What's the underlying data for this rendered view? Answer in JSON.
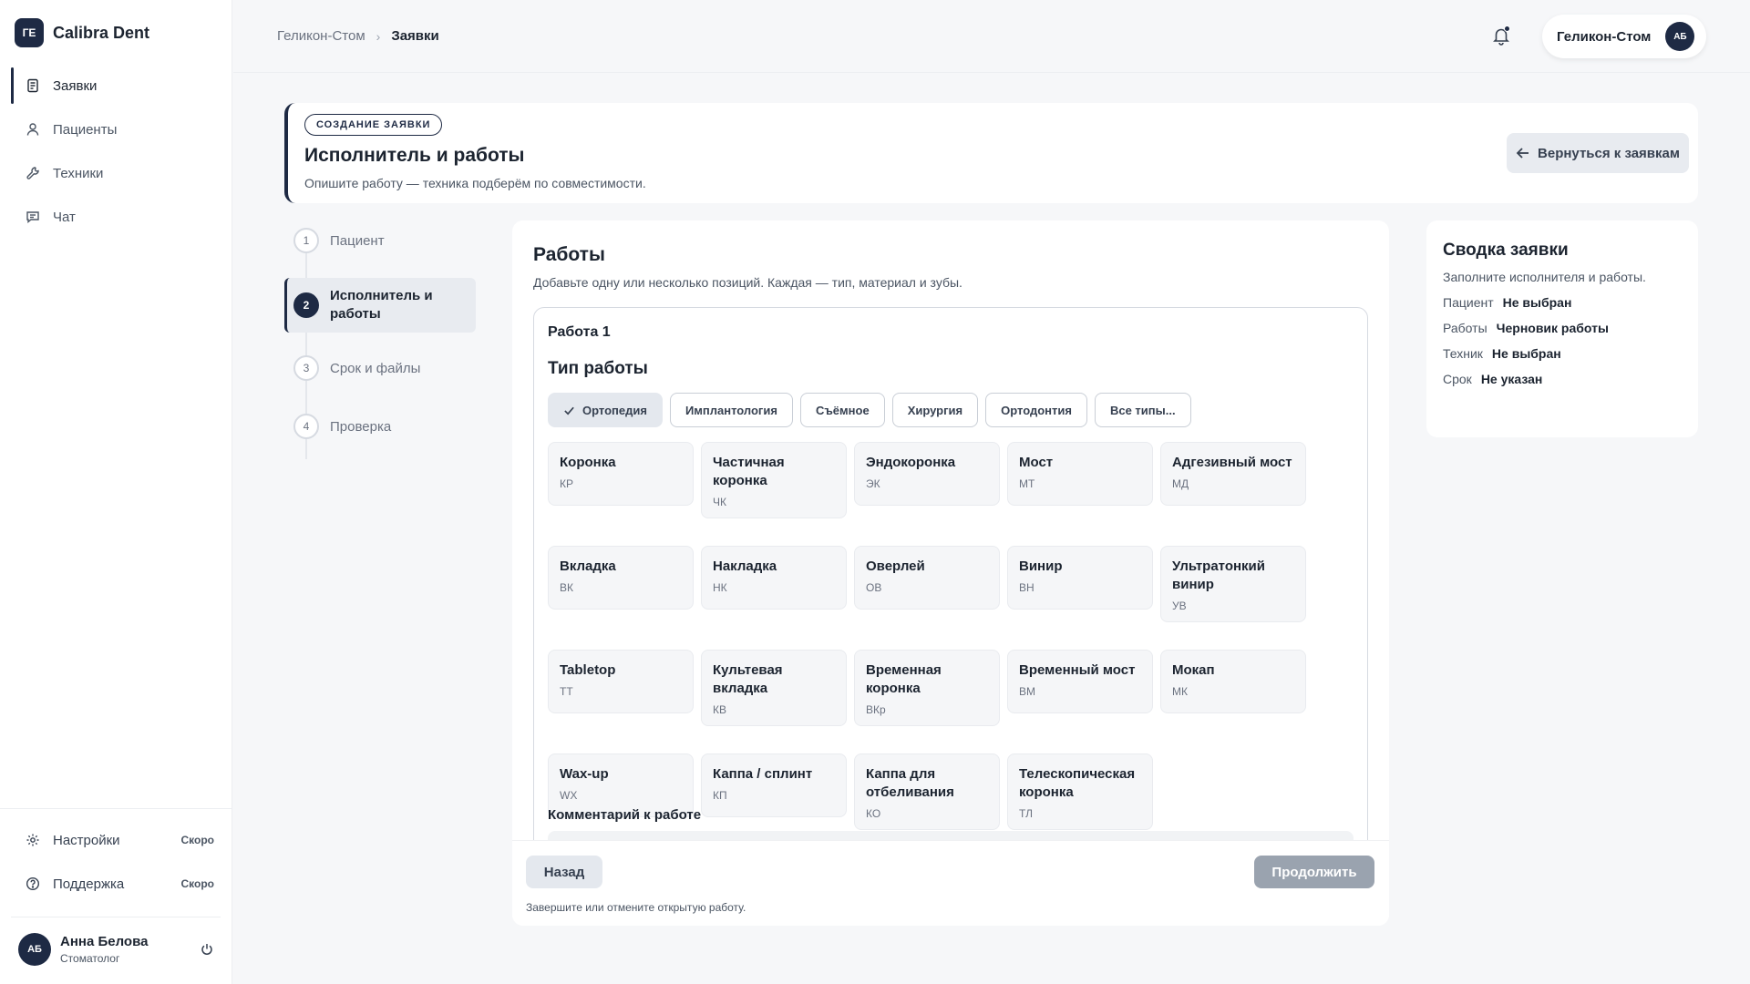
{
  "brand": {
    "logo": "ГЕ",
    "name": "Calibra Dent"
  },
  "nav": [
    {
      "label": "Заявки",
      "icon": "document-icon",
      "active": true
    },
    {
      "label": "Пациенты",
      "icon": "user-icon",
      "active": false
    },
    {
      "label": "Техники",
      "icon": "wrench-icon",
      "active": false
    },
    {
      "label": "Чат",
      "icon": "chat-icon",
      "active": false
    }
  ],
  "bottom_nav": [
    {
      "label": "Настройки",
      "badge": "Скоро",
      "icon": "gear-icon"
    },
    {
      "label": "Поддержка",
      "badge": "Скоро",
      "icon": "help-icon"
    }
  ],
  "user": {
    "initials": "АБ",
    "name": "Анна Белова",
    "role": "Стоматолог"
  },
  "breadcrumb": {
    "parent": "Геликон-Стом",
    "current": "Заявки"
  },
  "org": {
    "name": "Геликон-Стом",
    "initials": "АБ"
  },
  "header": {
    "badge": "СОЗДАНИЕ ЗАЯВКИ",
    "title": "Исполнитель и работы",
    "subtitle": "Опишите работу — техника подберём по совместимости.",
    "back_label": "Вернуться к заявкам"
  },
  "steps": [
    {
      "num": "1",
      "label": "Пациент"
    },
    {
      "num": "2",
      "label": "Исполнитель и работы"
    },
    {
      "num": "3",
      "label": "Срок и файлы"
    },
    {
      "num": "4",
      "label": "Проверка"
    }
  ],
  "works": {
    "title": "Работы",
    "subtitle": "Добавьте одну или несколько позиций. Каждая — тип, материал и зубы.",
    "work_name": "Работа 1",
    "type_title": "Тип работы",
    "categories": [
      {
        "label": "Ортопедия",
        "selected": true
      },
      {
        "label": "Имплантология",
        "selected": false
      },
      {
        "label": "Съёмное",
        "selected": false
      },
      {
        "label": "Хирургия",
        "selected": false
      },
      {
        "label": "Ортодонтия",
        "selected": false
      },
      {
        "label": "Все типы...",
        "selected": false
      }
    ],
    "types": [
      {
        "name": "Коронка",
        "code": "КР"
      },
      {
        "name": "Частичная коронка",
        "code": "ЧК"
      },
      {
        "name": "Эндокоронка",
        "code": "ЭК"
      },
      {
        "name": "Мост",
        "code": "МТ"
      },
      {
        "name": "Адгезивный мост",
        "code": "МД"
      },
      {
        "name": "Вкладка",
        "code": "ВК"
      },
      {
        "name": "Накладка",
        "code": "НК"
      },
      {
        "name": "Оверлей",
        "code": "ОВ"
      },
      {
        "name": "Винир",
        "code": "ВН"
      },
      {
        "name": "Ультратонкий винир",
        "code": "УВ"
      },
      {
        "name": "Tabletop",
        "code": "ТТ"
      },
      {
        "name": "Культевая вкладка",
        "code": "КВ"
      },
      {
        "name": "Временная коронка",
        "code": "ВКр"
      },
      {
        "name": "Временный мост",
        "code": "ВМ"
      },
      {
        "name": "Мокап",
        "code": "МК"
      },
      {
        "name": "Wax-up",
        "code": "WX"
      },
      {
        "name": "Каппа / сплинт",
        "code": "КП"
      },
      {
        "name": "Каппа для отбеливания",
        "code": "КО"
      },
      {
        "name": "Телескопическая коронка",
        "code": "ТЛ"
      }
    ],
    "comment_label": "Комментарий к работе",
    "back_button": "Назад",
    "continue_button": "Продолжить",
    "footer_hint": "Завершите или отмените открытую работу."
  },
  "summary": {
    "title": "Сводка заявки",
    "subtitle": "Заполните исполнителя и работы.",
    "rows": [
      {
        "key": "Пациент",
        "value": "Не выбран"
      },
      {
        "key": "Работы",
        "value": "Черновик работы"
      },
      {
        "key": "Техник",
        "value": "Не выбран"
      },
      {
        "key": "Срок",
        "value": "Не указан"
      }
    ]
  },
  "colors": {
    "accent": "#1e2a44",
    "background": "#f6f7f9",
    "card": "#ffffff",
    "muted": "#6b7280"
  }
}
